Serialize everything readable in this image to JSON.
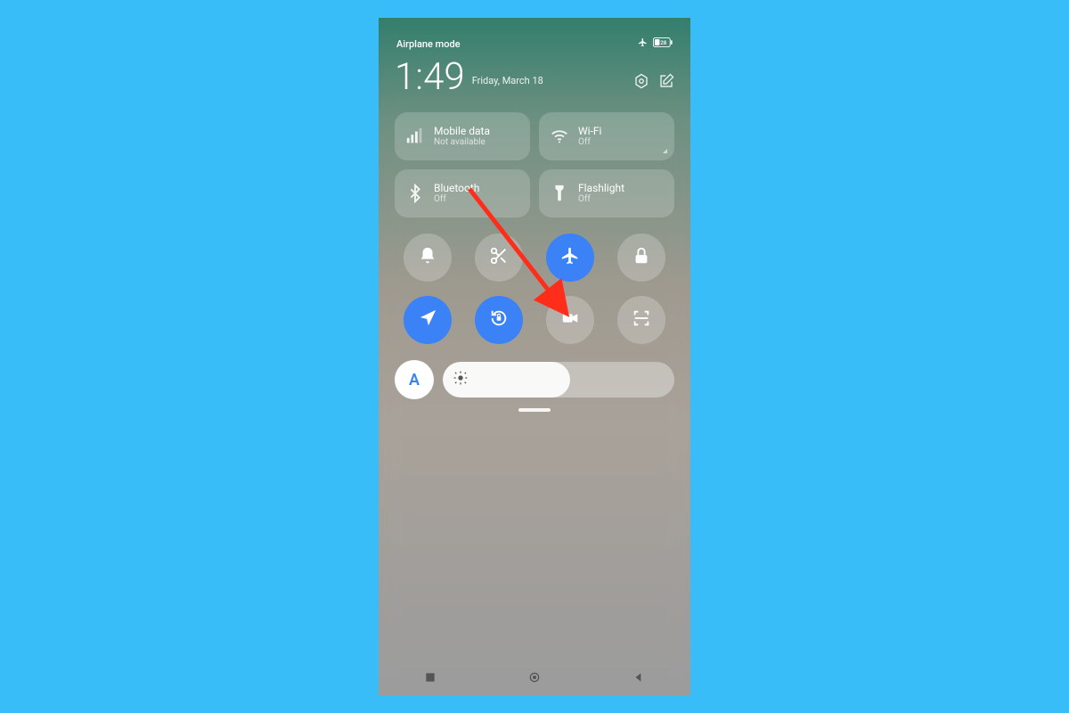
{
  "statusbar": {
    "label": "Airplane mode",
    "battery": "28"
  },
  "clock": {
    "time": "1:49",
    "date": "Friday, March 18"
  },
  "tiles_large": [
    {
      "id": "mobile-data",
      "title": "Mobile data",
      "sub": "Not available"
    },
    {
      "id": "wifi",
      "title": "Wi-Fi",
      "sub": "Off"
    },
    {
      "id": "bluetooth",
      "title": "Bluetooth",
      "sub": "Off"
    },
    {
      "id": "flashlight",
      "title": "Flashlight",
      "sub": "Off"
    }
  ],
  "tiles_small": [
    {
      "id": "mute",
      "icon": "bell",
      "active": false
    },
    {
      "id": "screenshot",
      "icon": "scissors",
      "active": false
    },
    {
      "id": "airplane",
      "icon": "airplane",
      "active": true
    },
    {
      "id": "lock",
      "icon": "lock",
      "active": false
    },
    {
      "id": "location",
      "icon": "navigate",
      "active": true
    },
    {
      "id": "rotation-lock",
      "icon": "rotate-lock",
      "active": true
    },
    {
      "id": "screen-record",
      "icon": "video",
      "active": false
    },
    {
      "id": "scanner",
      "icon": "scan",
      "active": false
    }
  ],
  "brightness": {
    "auto_label": "A",
    "percent": 55
  },
  "annotation": {
    "arrow_target": "airplane"
  },
  "colors": {
    "background": "#38bdf8",
    "accent": "#3b82f6",
    "arrow": "#ff2d1a"
  }
}
